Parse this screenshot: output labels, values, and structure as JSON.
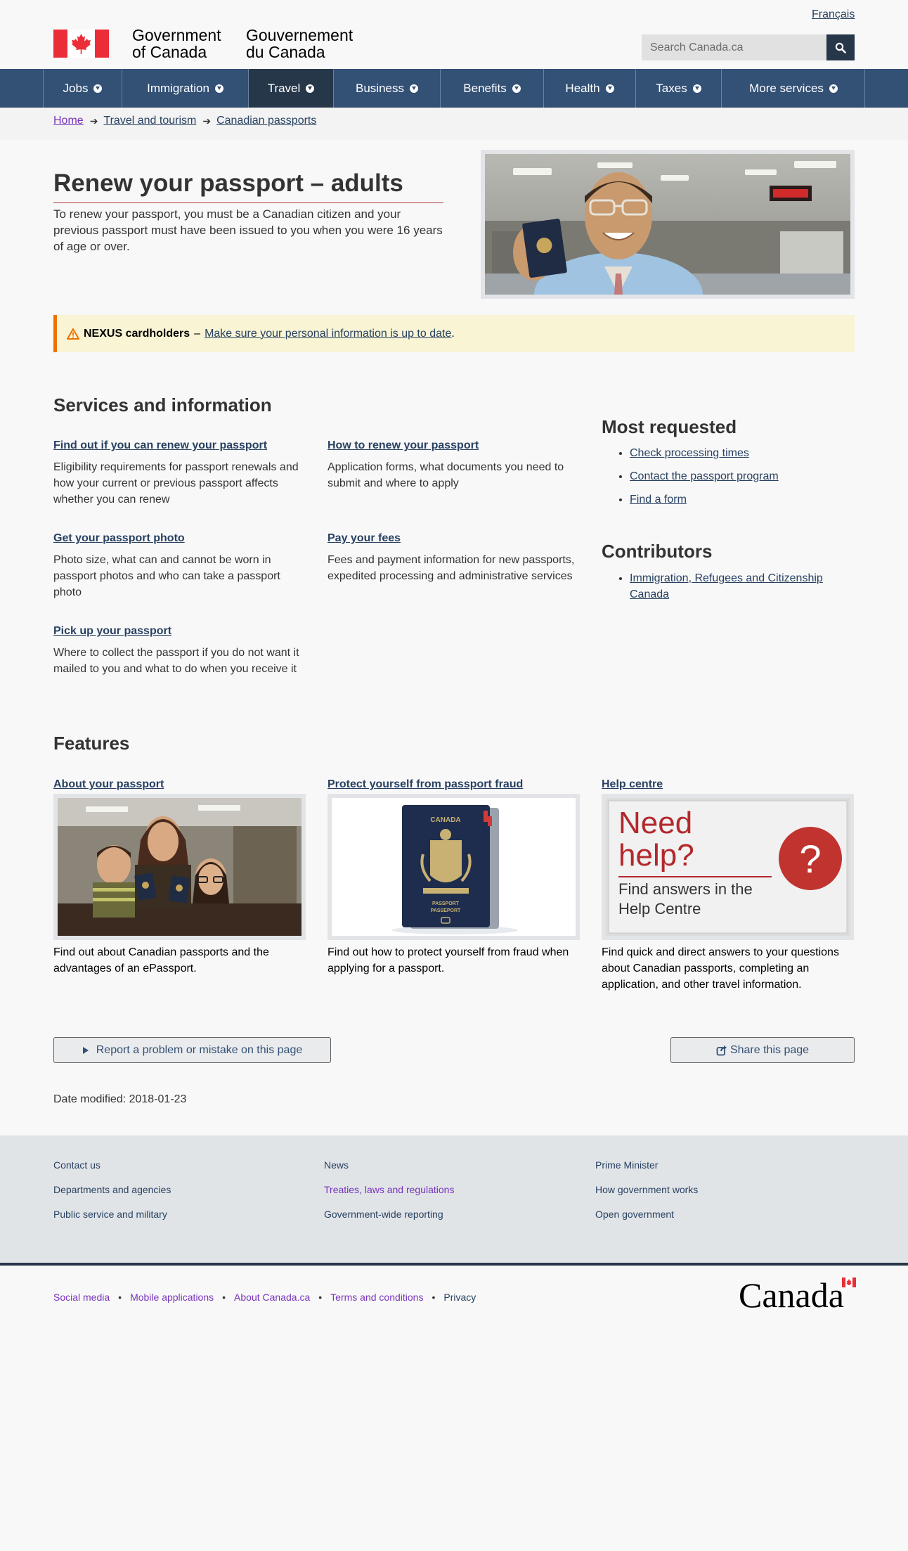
{
  "header": {
    "lang_toggle": "Français",
    "gov_en_line1": "Government",
    "gov_en_line2": "of Canada",
    "gov_fr_line1": "Gouvernement",
    "gov_fr_line2": "du Canada",
    "search_placeholder": "Search Canada.ca"
  },
  "nav": {
    "items": [
      {
        "label": "Jobs"
      },
      {
        "label": "Immigration"
      },
      {
        "label": "Travel"
      },
      {
        "label": "Business"
      },
      {
        "label": "Benefits"
      },
      {
        "label": "Health"
      },
      {
        "label": "Taxes"
      },
      {
        "label": "More services"
      }
    ],
    "active": "Travel"
  },
  "breadcrumb": [
    "Home",
    "Travel and tourism",
    "Canadian passports"
  ],
  "hero": {
    "title": "Renew your passport – adults",
    "intro": "To renew your passport, you must be a Canadian citizen and your previous passport must have been issued to you when you were 16 years of age or over."
  },
  "alert": {
    "strong": "NEXUS cardholders",
    "dash": "–",
    "link": "Make sure your personal information is up to date",
    "end": "."
  },
  "services": {
    "heading": "Services and information",
    "items": [
      {
        "title": "Find out if you can renew your passport",
        "desc": "Eligibility requirements for passport renewals and how your current or previous passport affects whether you can renew"
      },
      {
        "title": "How to renew your passport",
        "desc": "Application forms, what documents you need to submit and where to apply"
      },
      {
        "title": "Get your passport photo",
        "desc": "Photo size, what can and cannot be worn in passport photos and who can take a passport photo"
      },
      {
        "title": "Pay your fees",
        "desc": "Fees and payment information for new passports, expedited processing and administrative services"
      },
      {
        "title": "Pick up your passport",
        "desc": "Where to collect the passport if you do not want it mailed to you and what to do when you receive it"
      }
    ]
  },
  "most_requested": {
    "heading": "Most requested",
    "links": [
      "Check processing times",
      "Contact the passport program",
      "Find a form"
    ]
  },
  "contributors": {
    "heading": "Contributors",
    "links": [
      "Immigration, Refugees and Citizenship Canada"
    ]
  },
  "features": {
    "heading": "Features",
    "items": [
      {
        "title": "About your passport",
        "desc": "Find out about Canadian passports and the advantages of an ePassport."
      },
      {
        "title": "Protect yourself from passport fraud",
        "desc": "Find out how to protect yourself from fraud when applying for a passport."
      },
      {
        "title": "Help centre",
        "desc": "Find quick and direct answers to your questions about Canadian passports, completing an application, and other travel information."
      }
    ],
    "passport_cover_text": [
      "CANADA",
      "PASSPORT",
      "PASSEPORT"
    ],
    "help_image": {
      "line1": "Need",
      "line2": "help?",
      "line3": "Find answers in the",
      "line4": "Help Centre",
      "symbol": "?"
    }
  },
  "actions": {
    "report": "Report a problem or mistake on this page",
    "share": "Share this page"
  },
  "date_modified": "Date modified: 2018-01-23",
  "footer": {
    "col1": [
      "Contact us",
      "Departments and agencies",
      "Public service and military"
    ],
    "col2": [
      "News",
      "Treaties, laws and regulations",
      "Government-wide reporting"
    ],
    "col3": [
      "Prime Minister",
      "How government works",
      "Open government"
    ],
    "bottom": [
      "Social media",
      "Mobile applications",
      "About Canada.ca",
      "Terms and conditions",
      "Privacy"
    ],
    "wordmark": "Canada"
  },
  "colors": {
    "nav_bg": "#335075",
    "nav_active": "#26374a",
    "link": "#284162",
    "visited": "#7834bc",
    "flag_red": "#eb2d37",
    "alert_bg": "#f9f4d4",
    "alert_border": "#ee7100"
  }
}
